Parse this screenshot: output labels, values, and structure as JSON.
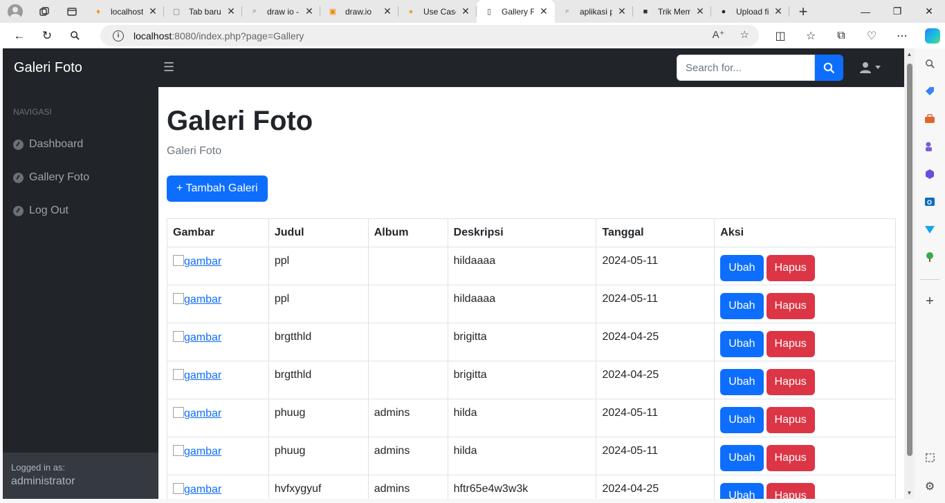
{
  "browser": {
    "tabs": [
      {
        "title": "localhost",
        "fav": "pma",
        "favcolor": "#f29111"
      },
      {
        "title": "Tab baru",
        "fav": "newtab",
        "favcolor": "#7a7a7a"
      },
      {
        "title": "draw io -",
        "fav": "search",
        "favcolor": "#5b6f9e"
      },
      {
        "title": "draw.io",
        "fav": "drawio",
        "favcolor": "#f08705"
      },
      {
        "title": "Use Case",
        "fav": "usecase",
        "favcolor": "#e8a33d"
      },
      {
        "title": "Gallery Fo",
        "fav": "page",
        "favcolor": "#444444"
      },
      {
        "title": "aplikasi p",
        "fav": "search",
        "favcolor": "#5b6f9e"
      },
      {
        "title": "Trik Mem",
        "fav": "video",
        "favcolor": "#333333"
      },
      {
        "title": "Upload fi",
        "fav": "github",
        "favcolor": "#222222"
      }
    ],
    "url_host": "localhost",
    "url_rest": ":8080/index.php?page=Gallery"
  },
  "app": {
    "brand": "Galeri Foto",
    "search_placeholder": "Search for..."
  },
  "sidebar": {
    "heading": "Navigasi",
    "items": [
      {
        "label": "Dashboard"
      },
      {
        "label": "Gallery Foto"
      },
      {
        "label": "Log Out"
      }
    ],
    "footer_label": "Logged in as:",
    "footer_user": "administrator"
  },
  "main": {
    "title": "Galeri Foto",
    "breadcrumb": "Galeri Foto",
    "add_button": "+ Tambah Galeri",
    "table": {
      "headers": [
        "Gambar",
        "Judul",
        "Album",
        "Deskripsi",
        "Tanggal",
        "Aksi"
      ],
      "image_alt": "gambar",
      "edit_label": "Ubah",
      "delete_label": "Hapus",
      "rows": [
        {
          "judul": "ppl",
          "album": "",
          "deskripsi": "hildaaaa",
          "tanggal": "2024-05-11"
        },
        {
          "judul": "ppl",
          "album": "",
          "deskripsi": "hildaaaa",
          "tanggal": "2024-05-11"
        },
        {
          "judul": "brgtthld",
          "album": "",
          "deskripsi": "brigitta",
          "tanggal": "2024-04-25"
        },
        {
          "judul": "brgtthld",
          "album": "",
          "deskripsi": "brigitta",
          "tanggal": "2024-04-25"
        },
        {
          "judul": "phuug",
          "album": "admins",
          "deskripsi": "hilda",
          "tanggal": "2024-05-11"
        },
        {
          "judul": "phuug",
          "album": "admins",
          "deskripsi": "hilda",
          "tanggal": "2024-05-11"
        },
        {
          "judul": "hvfxygyuf",
          "album": "admins",
          "deskripsi": "hftr65e4w3w3k",
          "tanggal": "2024-04-25"
        }
      ]
    }
  },
  "colors": {
    "primary": "#0d6efd",
    "danger": "#dc3545",
    "dark": "#212529"
  }
}
